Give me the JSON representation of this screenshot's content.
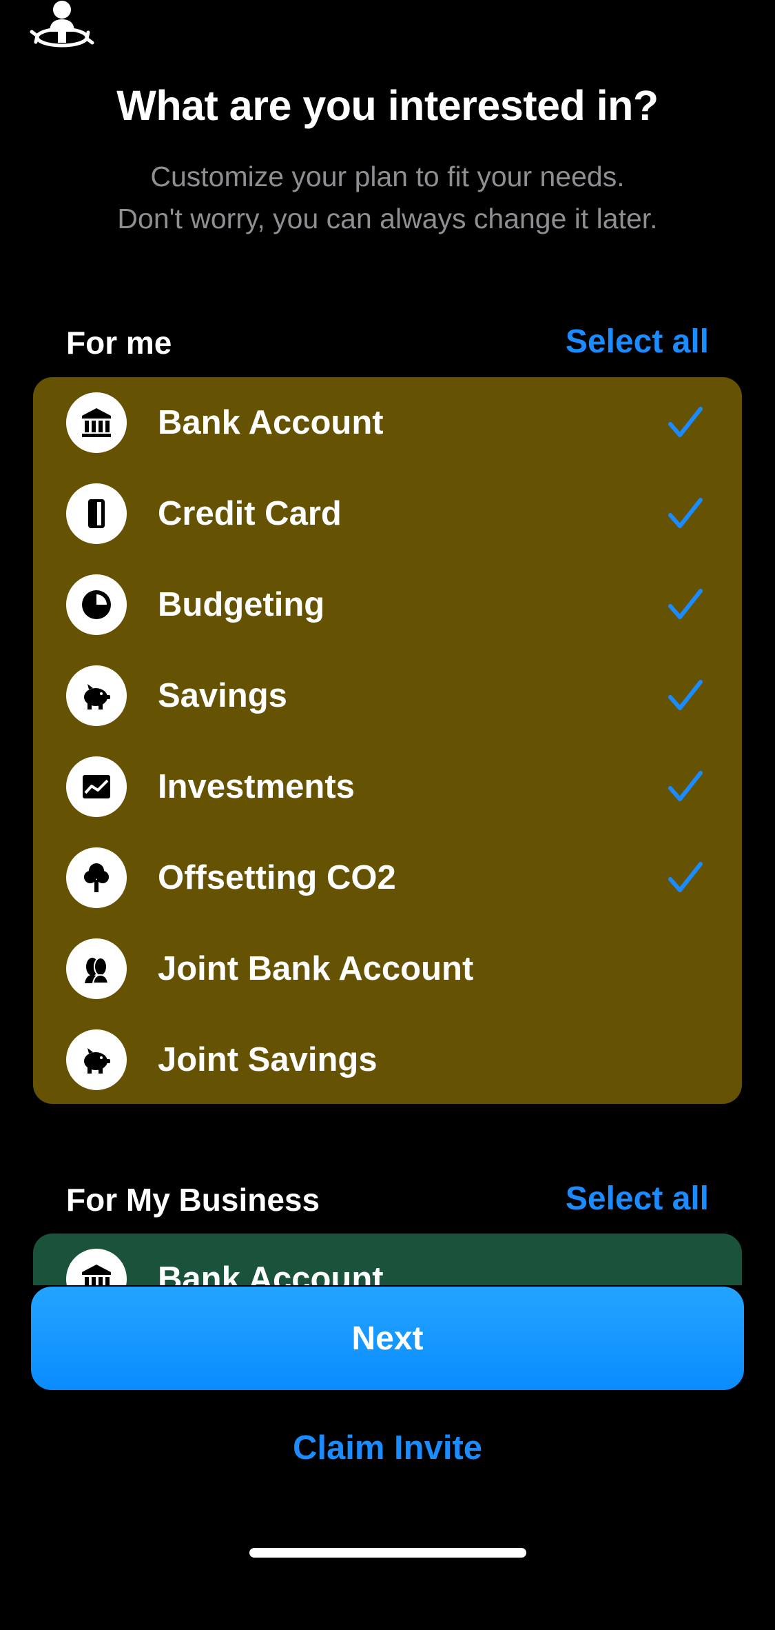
{
  "header": {
    "logo_icon": "user-rotate-icon",
    "title": "What are you interested in?",
    "subtitle_lines": [
      "Customize your plan to fit your needs.",
      "Don't worry, you can always change it later."
    ]
  },
  "sections": {
    "for_me": {
      "title": "For me",
      "select_all_label": "Select all",
      "card_color": "#655203",
      "items": [
        {
          "label": "Bank Account",
          "icon": "bank-icon",
          "checked": true
        },
        {
          "label": "Credit Card",
          "icon": "credit-card-icon",
          "checked": true
        },
        {
          "label": "Budgeting",
          "icon": "pie-chart-icon",
          "checked": true
        },
        {
          "label": "Savings",
          "icon": "piggy-bank-icon",
          "checked": true
        },
        {
          "label": "Investments",
          "icon": "chart-icon",
          "checked": true
        },
        {
          "label": "Offsetting CO2",
          "icon": "tree-icon",
          "checked": true
        },
        {
          "label": "Joint Bank Account",
          "icon": "people-icon",
          "checked": false
        },
        {
          "label": "Joint Savings",
          "icon": "piggy-bank-icon",
          "checked": false
        }
      ]
    },
    "for_business": {
      "title": "For My Business",
      "select_all_label": "Select all",
      "card_color": "#1a523a",
      "items": [
        {
          "label": "Bank Account",
          "icon": "bank-icon",
          "checked": false
        }
      ]
    }
  },
  "footer": {
    "next_label": "Next",
    "claim_label": "Claim Invite"
  },
  "colors": {
    "accent": "#1a8cff",
    "background": "#000000",
    "muted_text": "#8e8e93"
  }
}
